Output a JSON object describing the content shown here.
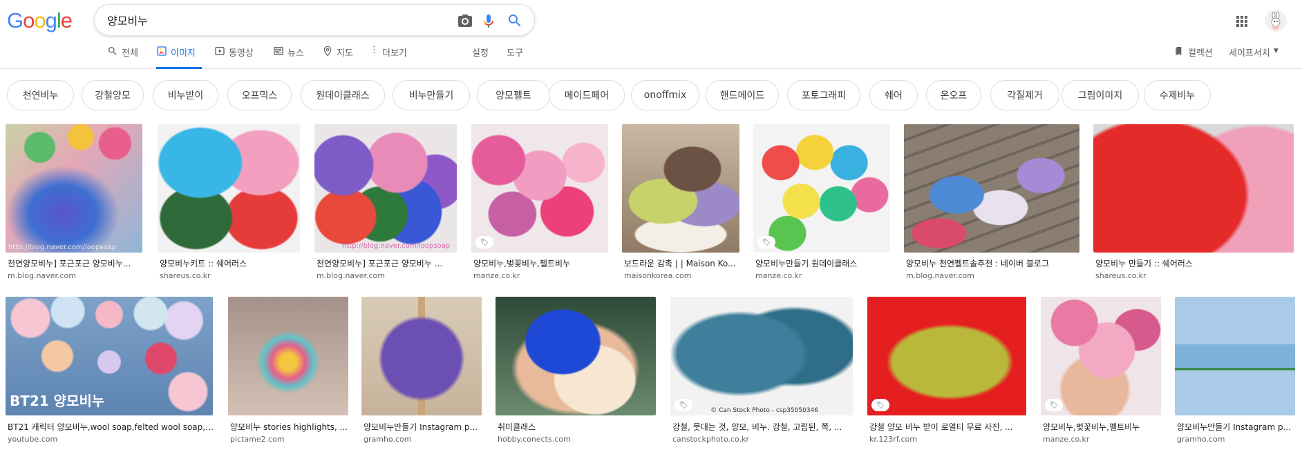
{
  "search": {
    "query": "양모비누"
  },
  "nav": {
    "tabs": [
      {
        "label": "전체"
      },
      {
        "label": "이미지"
      },
      {
        "label": "동영상"
      },
      {
        "label": "뉴스"
      },
      {
        "label": "지도"
      },
      {
        "label": "더보기"
      }
    ],
    "settings": "설정",
    "tools": "도구",
    "collections": "컬렉션",
    "safesearch": "세이프서치"
  },
  "chips": [
    "천연비누",
    "강철양모",
    "비누받이",
    "오프믹스",
    "원데이클래스",
    "비누만들기",
    "양모펠트",
    "메이드페어",
    "onoffmix",
    "핸드메이드",
    "포토그래피",
    "쉐어",
    "온오프",
    "각질제거",
    "그림이미지",
    "수제비누"
  ],
  "results_row1": [
    {
      "title": "천연양모비누] 포근포근 양모비누...",
      "domain": "m.blog.naver.com",
      "watermark": "http://blog.naver.com/loopsoap"
    },
    {
      "title": "양모비누키트 :: 쉐어러스",
      "domain": "shareus.co.kr"
    },
    {
      "title": "천연양모비누] 포근포근 양모비누 ...",
      "domain": "m.blog.naver.com",
      "watermark": "http://blog.naver.com/loopsoap"
    },
    {
      "title": "양모비누,벚꽃비누,펠트비누",
      "domain": "manze.co.kr"
    },
    {
      "title": "보드라운 감촉 | | Maison Ko...",
      "domain": "maisonkorea.com"
    },
    {
      "title": "양모비누만들기 원데이클래스",
      "domain": "manze.co.kr"
    },
    {
      "title": "양모비누 천연펠트솔추천 : 네이버 블로그",
      "domain": "m.blog.naver.com"
    },
    {
      "title": "양모비누 만들기 :: 쉐어러스",
      "domain": "shareus.co.kr"
    }
  ],
  "results_row2": [
    {
      "title": "BT21 캐릭터 양모비누,wool soap,felted wool soap,k...",
      "domain": "youtube.com",
      "overlay": "BT21 양모비누"
    },
    {
      "title": "양모비누 stories highlights, ...",
      "domain": "pictame2.com"
    },
    {
      "title": "양모비누만들기 Instagram p...",
      "domain": "gramho.com"
    },
    {
      "title": "취미클래스",
      "domain": "hobby.conects.com"
    },
    {
      "title": "강철, 뭇대는 것, 양모, 비누. 강철, 고립된, 쪽, ...",
      "domain": "canstockphoto.co.kr",
      "watermark": "© Can Stock Photo - csp35050346"
    },
    {
      "title": "강철 양모 비누 받이 로열티 무료 사진, ...",
      "domain": "kr.123rf.com"
    },
    {
      "title": "양모비누,벚꽃비누,펠트비누",
      "domain": "manze.co.kr"
    },
    {
      "title": "양모비누만들기 Instagram p...",
      "domain": "gramho.com"
    }
  ],
  "colors": {
    "accent": "#1a73e8",
    "border": "#dfe1e5",
    "muted": "#5f6368"
  }
}
